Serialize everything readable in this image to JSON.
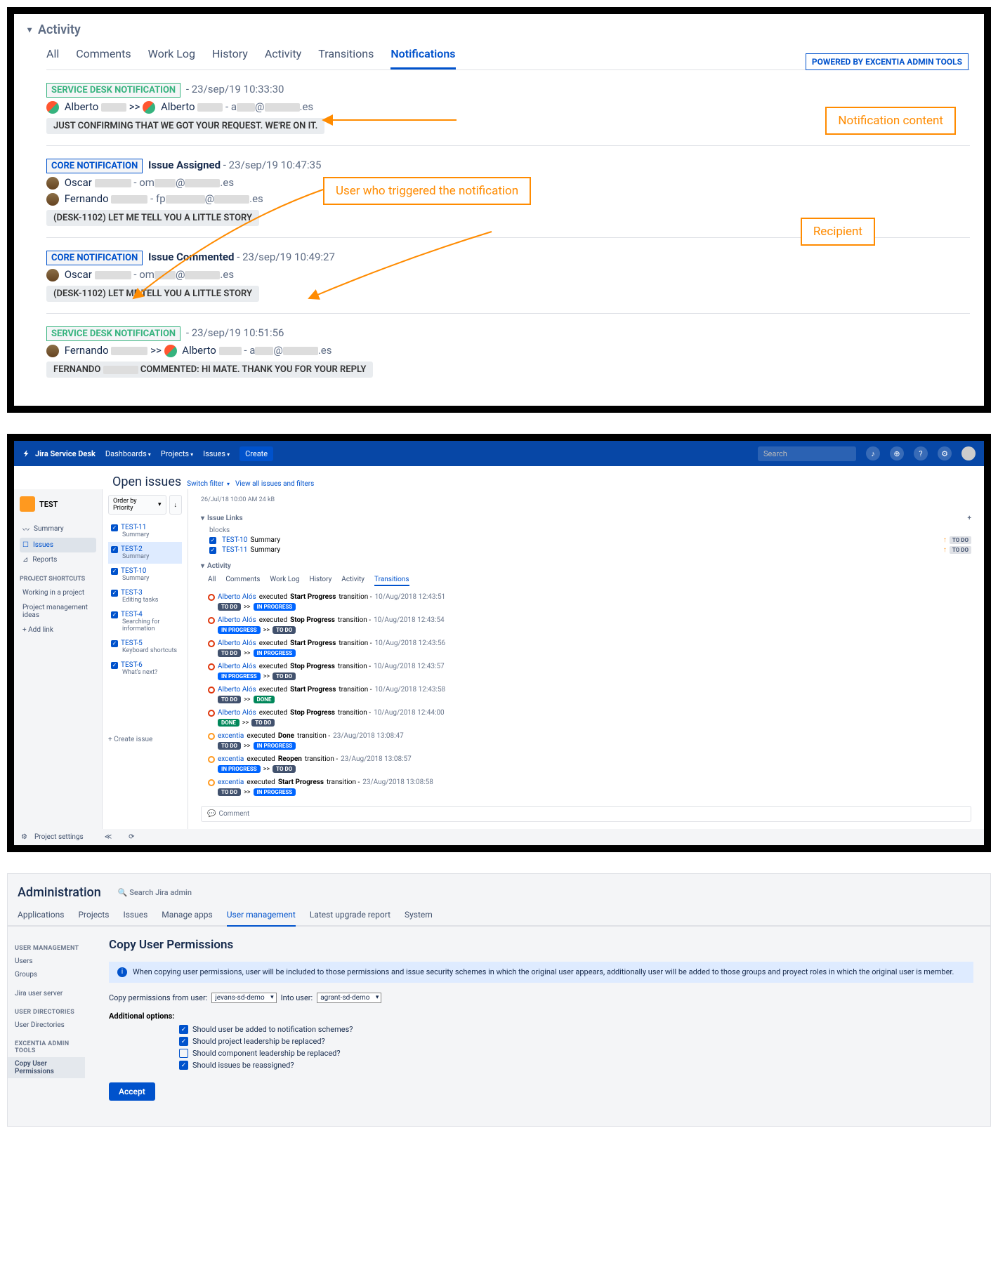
{
  "p1": {
    "section": "Activity",
    "tabs": [
      "All",
      "Comments",
      "Work Log",
      "History",
      "Activity",
      "Transitions",
      "Notifications"
    ],
    "powered": "POWERED BY EXCENTIA ADMIN TOOLS",
    "callouts": {
      "content": "Notification content",
      "trigger": "User who triggered the notification",
      "recipient": "Recipient"
    },
    "n1": {
      "tag": "SERVICE DESK NOTIFICATION",
      "date": "- 23/sep/19 10:33:30",
      "from": "Alberto",
      "to": "Alberto",
      "email_tail": ".es",
      "sep": ">> ",
      "dash": "- a",
      "at": "@",
      "msg": "JUST CONFIRMING THAT WE GOT YOUR REQUEST. WE'RE ON IT."
    },
    "n2": {
      "tag": "CORE NOTIFICATION",
      "title": "Issue Assigned",
      "date": "- 23/sep/19 10:47:35",
      "u1": "Oscar",
      "u1e": "- om",
      "u2": "Fernando",
      "u2e": "- fp",
      "at": "@",
      "tail": ".es",
      "msg": "(DESK-1102) LET ME TELL YOU A LITTLE STORY"
    },
    "n3": {
      "tag": "CORE NOTIFICATION",
      "title": "Issue Commented",
      "date": "- 23/sep/19 10:49:27",
      "u1": "Oscar",
      "u1e": "- om",
      "at": "@",
      "tail": ".es",
      "msg": "(DESK-1102) LET ME TELL YOU A LITTLE STORY"
    },
    "n4": {
      "tag": "SERVICE DESK NOTIFICATION",
      "date": "- 23/sep/19 10:51:56",
      "from": "Fernando",
      "to": "Alberto",
      "sep": ">> ",
      "dash": "- a",
      "at": "@",
      "tail": ".es",
      "msg_pref": "FERNANDO",
      "msg_tail": "COMMENTED: HI MATE. THANK YOU FOR YOUR REPLY"
    }
  },
  "p2": {
    "brand": "Jira Service Desk",
    "nav": [
      "Dashboards",
      "Projects",
      "Issues"
    ],
    "create": "Create",
    "search": "Search",
    "project": "TEST",
    "side": [
      "Summary",
      "Issues",
      "Reports"
    ],
    "side_hdr": "PROJECT SHORTCUTS",
    "shortcuts": [
      "Working in a project",
      "Project management ideas"
    ],
    "add_link": "+   Add link",
    "settings": "Project settings",
    "open_title": "Open issues",
    "switch": "Switch filter",
    "view_all": "View all issues and filters",
    "order": "Order by Priority",
    "issues": [
      {
        "key": "TEST-11",
        "sum": "Summary"
      },
      {
        "key": "TEST-2",
        "sum": "Summary"
      },
      {
        "key": "TEST-10",
        "sum": "Summary"
      },
      {
        "key": "TEST-3",
        "sum": "Editing tasks"
      },
      {
        "key": "TEST-4",
        "sum": "Searching for information"
      },
      {
        "key": "TEST-5",
        "sum": "Keyboard shortcuts"
      },
      {
        "key": "TEST-6",
        "sum": "What's next?"
      }
    ],
    "create_issue": "+ Create issue",
    "meta": "26/Jul/18 10:00 AM        24 kB",
    "links_hdr": "Issue Links",
    "blocks": "blocks",
    "links": [
      {
        "k": "TEST-10",
        "s": "Summary",
        "st": "TO DO"
      },
      {
        "k": "TEST-11",
        "s": "Summary",
        "st": "TO DO"
      }
    ],
    "activity": "Activity",
    "tabs": [
      "All",
      "Comments",
      "Work Log",
      "History",
      "Activity",
      "Transitions"
    ],
    "trans": [
      {
        "u": "Alberto Alós",
        "a": "Start Progress",
        "d": "10/Aug/2018 12:43:51",
        "f": "TO DO",
        "t": "IN PROGRESS",
        "bt": "inprog",
        "bf": "todo",
        "ring": "red"
      },
      {
        "u": "Alberto Alós",
        "a": "Stop Progress",
        "d": "10/Aug/2018 12:43:54",
        "f": "IN PROGRESS",
        "t": "TO DO",
        "bt": "todo",
        "bf": "inprog",
        "ring": "red"
      },
      {
        "u": "Alberto Alós",
        "a": "Start Progress",
        "d": "10/Aug/2018 12:43:56",
        "f": "TO DO",
        "t": "IN PROGRESS",
        "bt": "inprog",
        "bf": "todo",
        "ring": "red"
      },
      {
        "u": "Alberto Alós",
        "a": "Stop Progress",
        "d": "10/Aug/2018 12:43:57",
        "f": "IN PROGRESS",
        "t": "TO DO",
        "bt": "todo",
        "bf": "inprog",
        "ring": "red"
      },
      {
        "u": "Alberto Alós",
        "a": "Start Progress",
        "d": "10/Aug/2018 12:43:58",
        "f": "TO DO",
        "t": "DONE",
        "bt": "done",
        "bf": "todo",
        "ring": "red"
      },
      {
        "u": "Alberto Alós",
        "a": "Stop Progress",
        "d": "10/Aug/2018 12:44:00",
        "f": "DONE",
        "t": "TO DO",
        "bt": "todo",
        "bf": "done",
        "ring": "red"
      },
      {
        "u": "excentia",
        "a": "Done",
        "d": "23/Aug/2018 13:08:47",
        "f": "TO DO",
        "t": "IN PROGRESS",
        "bt": "inprog",
        "bf": "todo",
        "ring": "orange"
      },
      {
        "u": "excentia",
        "a": "Reopen",
        "d": "23/Aug/2018 13:08:57",
        "f": "IN PROGRESS",
        "t": "TO DO",
        "bt": "todo",
        "bf": "inprog",
        "ring": "orange"
      },
      {
        "u": "excentia",
        "a": "Start Progress",
        "d": "23/Aug/2018 13:08:58",
        "f": "TO DO",
        "t": "IN PROGRESS",
        "bt": "inprog",
        "bf": "todo",
        "ring": "orange"
      }
    ],
    "exec": " executed ",
    "trn": " transition - ",
    "arrow": ">>",
    "comment": "Comment"
  },
  "p3": {
    "title": "Administration",
    "search": "Search Jira admin",
    "tabs": [
      "Applications",
      "Projects",
      "Issues",
      "Manage apps",
      "User management",
      "Latest upgrade report",
      "System"
    ],
    "side": {
      "h1": "USER MANAGEMENT",
      "i1": [
        "Users",
        "Groups"
      ],
      "h2": "",
      "i2": [
        "Jira user server"
      ],
      "h3": "USER DIRECTORIES",
      "i3": [
        "User Directories"
      ],
      "h4": "EXCENTIA ADMIN TOOLS",
      "i4": [
        "Copy User Permissions"
      ]
    },
    "page_title": "Copy User Permissions",
    "info": "When copying user permissions, user will be included to those permissions and issue security schemes in which the original user appears, additionally user will be added to those groups and proyect roles in which the original user is member.",
    "from_label": "Copy permissions from user:",
    "from_val": "jevans-sd-demo",
    "to_label": "Into user:",
    "to_val": "agrant-sd-demo",
    "opts_label": "Additional options:",
    "opts": [
      {
        "t": "Should user be added to notification schemes?",
        "c": true
      },
      {
        "t": "Should project leadership be replaced?",
        "c": true
      },
      {
        "t": "Should component leadership be replaced?",
        "c": false
      },
      {
        "t": "Should issues be reassigned?",
        "c": true
      }
    ],
    "accept": "Accept"
  }
}
